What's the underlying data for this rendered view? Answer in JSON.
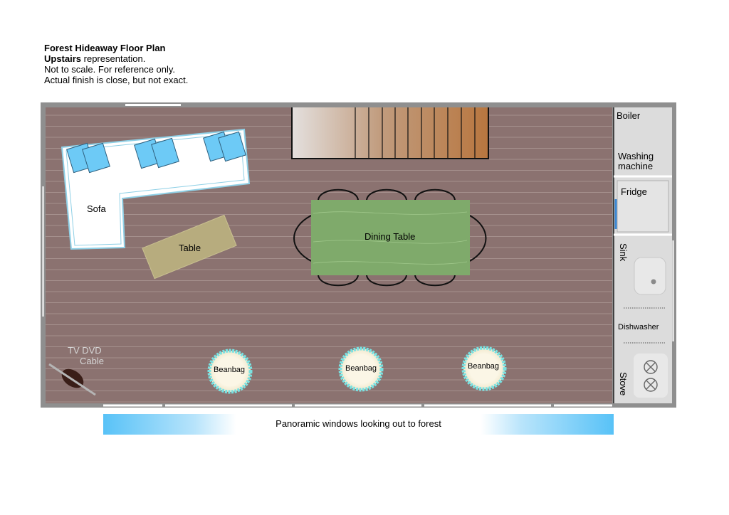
{
  "header": {
    "title": "Forest Hideaway Floor Plan",
    "subtitle_bold": "Upstairs",
    "subtitle_rest": " representation.",
    "note1": "Not to scale. For reference only.",
    "note2": "Actual finish is close, but not exact."
  },
  "rooms": {
    "boiler": "Boiler",
    "washing_1": "Washing",
    "washing_2": "machine",
    "fridge": "Fridge",
    "sink": "Sink",
    "dishwasher": "Dishwasher",
    "stove": "Stove"
  },
  "furniture": {
    "sofa": "Sofa",
    "table": "Table",
    "dining_table": "Dining Table",
    "tv_1": "TV DVD",
    "tv_2": "Cable",
    "beanbags": [
      "Beanbag",
      "Beanbag",
      "Beanbag"
    ]
  },
  "banner": "Panoramic windows looking out to forest",
  "colors": {
    "floor": "#8b7270",
    "wall": "#8f8f8f",
    "kitchen": "#dcdcdc",
    "dining": "#7faa6b",
    "coffee_table": "#b7ac7e",
    "cushion": "#6dcaf6",
    "beanbag": "#fbf6e6",
    "beanbag_ring": "#79e2e2"
  }
}
